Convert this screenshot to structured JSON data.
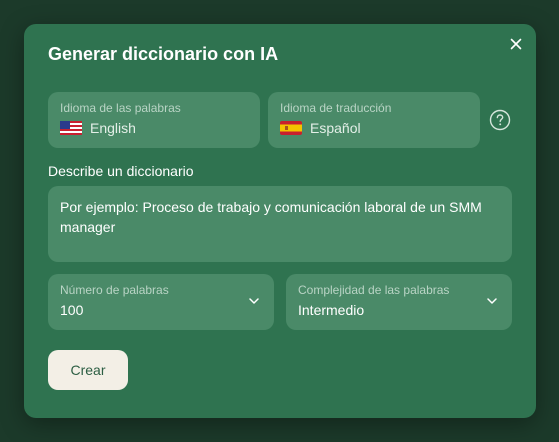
{
  "dialog": {
    "title": "Generar diccionario con IA"
  },
  "languages": {
    "source": {
      "label": "Idioma de las palabras",
      "value": "English",
      "flag_icon": "us-flag-icon"
    },
    "target": {
      "label": "Idioma de traducción",
      "value": "Español",
      "flag_icon": "spain-flag-icon"
    }
  },
  "description": {
    "label": "Describe un diccionario",
    "placeholder": "Por ejemplo: Proceso de trabajo y comunicación laboral de un SMM manager"
  },
  "word_count": {
    "label": "Número de palabras",
    "value": "100"
  },
  "complexity": {
    "label": "Complejidad de las palabras",
    "value": "Intermedio"
  },
  "actions": {
    "create_label": "Crear"
  },
  "colors": {
    "backdrop": "#1c3a2a",
    "modal": "#2f7350",
    "field": "#4a8a68",
    "button": "#f3efe6"
  }
}
